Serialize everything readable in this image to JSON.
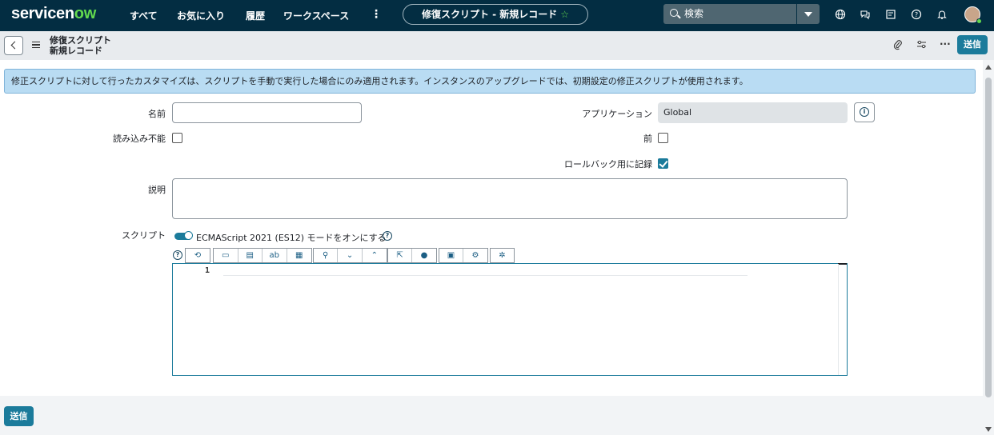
{
  "topnav": {
    "logo_a": "servicen",
    "logo_b": "ow",
    "items": [
      "すべて",
      "お気に入り",
      "履歴",
      "ワークスペース"
    ],
    "more": "⋮",
    "context_pill": "修復スクリプト - 新規レコード",
    "search_placeholder": "検索",
    "icons": [
      "globe-icon",
      "chat-icon",
      "document-icon",
      "help-icon",
      "bell-icon"
    ]
  },
  "header": {
    "title_line1": "修復スクリプト",
    "title_line2": "新規レコード",
    "submit_label": "送信",
    "icons": [
      "paperclip-icon",
      "settings-sliders-icon",
      "more-icon"
    ]
  },
  "banner": {
    "text": "修正スクリプトに対して行ったカスタマイズは、スクリプトを手動で実行した場合にのみ適用されます。インスタンスのアップグレードでは、初期設定の修正スクリプトが使用されます。"
  },
  "form": {
    "name_label": "名前",
    "name_value": "",
    "read_only_label": "読み込み不能",
    "read_only_checked": false,
    "application_label": "アプリケーション",
    "application_value": "Global",
    "before_label": "前",
    "before_checked": false,
    "record_rollback_label": "ロールバック用に記録",
    "record_rollback_checked": true,
    "description_label": "説明",
    "description_value": "",
    "script_label": "スクリプト",
    "es12_toggle_label": "ECMAScript 2021 (ES12) モードをオンにする",
    "es12_enabled": true
  },
  "editor": {
    "line_numbers": [
      "1"
    ],
    "toolbar_icons": [
      "format-icon",
      "comment-icon",
      "comment-block-icon",
      "replace-icon",
      "replace-all-icon",
      "search-icon",
      "find-next-icon",
      "find-prev-icon",
      "fullscreen-icon",
      "help-icon",
      "save-icon",
      "script-debugger-icon",
      "script-settings-icon"
    ]
  },
  "footer": {
    "submit_label": "送信"
  },
  "colors": {
    "nav_bg": "#032d42",
    "accent": "#1b7b9b",
    "brand_green": "#62d84e",
    "banner_bg": "#b9dcf3"
  }
}
